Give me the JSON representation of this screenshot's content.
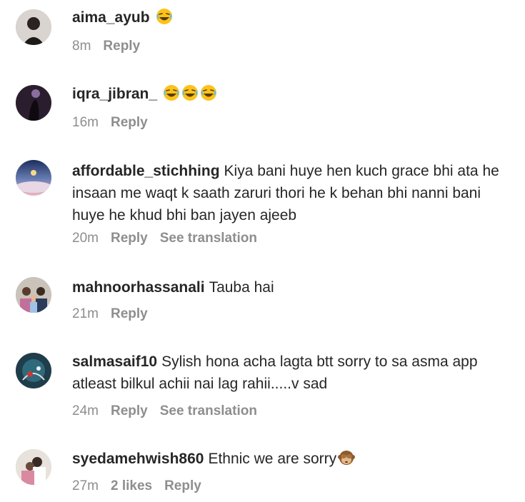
{
  "comments": [
    {
      "username": "aima_ayub",
      "text": "",
      "emoji": [
        "laughing"
      ],
      "time": "8m",
      "likes": "",
      "reply": "Reply",
      "translation": ""
    },
    {
      "username": "iqra_jibran_",
      "text": "",
      "emoji": [
        "laughing",
        "laughing",
        "laughing"
      ],
      "time": "16m",
      "likes": "",
      "reply": "Reply",
      "translation": ""
    },
    {
      "username": "affordable_stichhing",
      "text": "Kiya bani huye hen kuch grace bhi ata he insaan me waqt k saath zaruri thori he k behan bhi nanni bani huye he khud bhi ban jayen ajeeb",
      "emoji": [],
      "time": "20m",
      "likes": "",
      "reply": "Reply",
      "translation": "See translation"
    },
    {
      "username": "mahnoorhassanali",
      "text": "Tauba hai",
      "emoji": [],
      "time": "21m",
      "likes": "",
      "reply": "Reply",
      "translation": ""
    },
    {
      "username": "salmasaif10",
      "text": "Sylish hona acha lagta btt sorry to sa asma app atleast bilkul achii nai lag rahii.....v sad",
      "emoji": [],
      "time": "24m",
      "likes": "",
      "reply": "Reply",
      "translation": "See translation"
    },
    {
      "username": "syedamehwish860",
      "text": "Ethnic we are sorry",
      "emoji": [
        "see-no-evil-monkey"
      ],
      "time": "27m",
      "likes": "2 likes",
      "reply": "Reply",
      "translation": ""
    }
  ]
}
